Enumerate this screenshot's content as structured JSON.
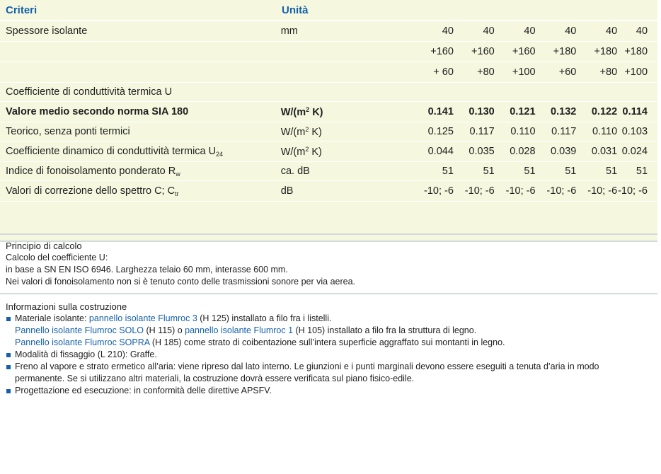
{
  "header": {
    "criteria": "Criteri",
    "unit": "Unità"
  },
  "thickness": {
    "label": "Spessore isolante",
    "unit": "mm",
    "line1": [
      "40",
      "40",
      "40",
      "40",
      "40",
      "40"
    ],
    "line2": [
      "+160",
      "+160",
      "+160",
      "+180",
      "+180",
      "+180"
    ],
    "line3": [
      "+ 60",
      "+80",
      "+100",
      "+60",
      "+80",
      "+100"
    ]
  },
  "u_title": "Coefficiente di conduttività termica U",
  "rows": {
    "sia": {
      "label": "Valore medio secondo norma SIA 180",
      "unit_pre": "W/(m",
      "unit_sup": "2",
      "unit_post": " K)",
      "values": [
        "0.141",
        "0.130",
        "0.121",
        "0.132",
        "0.122",
        "0.114"
      ]
    },
    "teorico": {
      "label": "Teorico, senza ponti termici",
      "unit_pre": "W/(m",
      "unit_sup": "2",
      "unit_post": " K)",
      "values": [
        "0.125",
        "0.117",
        "0.110",
        "0.117",
        "0.110",
        "0.103"
      ]
    },
    "dinamico": {
      "label": "Coefficiente dinamico di conduttività termica U",
      "label_sub": "24",
      "unit_pre": "W/(m",
      "unit_sup": "2",
      "unit_post": " K)",
      "values": [
        "0.044",
        "0.035",
        "0.028",
        "0.039",
        "0.031",
        "0.024"
      ]
    },
    "fono": {
      "label": "Indice di fonoisolamento ponderato R",
      "label_sub": "w",
      "unit": "ca. dB",
      "values": [
        "51",
        "51",
        "51",
        "51",
        "51",
        "51"
      ]
    },
    "correz": {
      "label": "Valori di correzione dello spettro C; C",
      "label_sub": "tr",
      "unit": "dB",
      "values": [
        "-10; -6",
        "-10; -6",
        "-10; -6",
        "-10; -6",
        "-10; -6",
        "-10; -6"
      ]
    }
  },
  "calc": {
    "title": "Principio di calcolo",
    "l1": "Calcolo del coefficiente U:",
    "l2": "in base a SN EN ISO 6946. Larghezza telaio 60 mm, interasse 600 mm.",
    "l3": "Nei valori di fonoisolamento non si è tenuto conto delle trasmissioni sonore per via aerea."
  },
  "build": {
    "title": "Informazioni sulla costruzione",
    "b1_pre": "Materiale isolante: ",
    "b1_link": "pannello isolante Flumroc 3",
    "b1_post": " (H 125) installato a filo fra i listelli.",
    "b1b_link1": "Pannello isolante Flumroc SOLO",
    "b1b_mid": " (H 115) o ",
    "b1b_link2": "pannello isolante Flumroc 1",
    "b1b_post": " (H 105) installato a filo fra la struttura di legno.",
    "b1c_link": "Pannello isolante Flumroc SOPRA",
    "b1c_post": " (H 185) come strato di coibentazione sull’intera superficie aggraffato sui montanti in legno.",
    "b2": "Modalità di fissaggio (L 210): Graffe.",
    "b3a": "Freno al vapore e strato ermetico all’aria: viene ripreso dal lato interno. Le giunzioni e i punti marginali devono essere eseguiti a tenuta d’aria in modo",
    "b3b": "permanente. Se si utilizzano altri materiali, la costruzione dovrà essere verificata sul piano fisico-edile.",
    "b4": "Progettazione ed esecuzione: in conformità delle direttive APSFV."
  },
  "colors": {
    "accent": "#1560a9",
    "table_bg": "#f5f8df",
    "separator": "#d3d9dd"
  }
}
